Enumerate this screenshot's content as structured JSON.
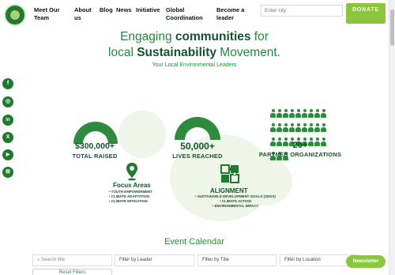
{
  "header": {
    "nav": [
      "Meet Our Team",
      "About us",
      "Blog",
      "News",
      "Initiative",
      "Global Coordination",
      "Become a leader"
    ],
    "search_placeholder": "Enter city",
    "donate_label": "DONATE"
  },
  "hero": {
    "line1_pre": "Engaging ",
    "line1_bold": "communities",
    "line1_post": " for",
    "line2_pre": "local ",
    "line2_bold": "Sustainability",
    "line2_post": " Movement.",
    "subtitle": "Your Local Environmental Leaders"
  },
  "social": [
    "f",
    "◎",
    "in",
    "X",
    "▶",
    "⊞"
  ],
  "social_icons": [
    "facebook-icon",
    "instagram-icon",
    "linkedin-icon",
    "x-icon",
    "youtube-icon",
    "blog-icon"
  ],
  "stats": [
    {
      "value": "$300,000+",
      "label": "TOTAL RAISED"
    },
    {
      "value": "50,000+",
      "label": "LIVES REACHED"
    },
    {
      "value": "20+",
      "label": "PARTNER ORGANIZATIONS"
    }
  ],
  "focus": {
    "title": "Focus Areas",
    "items": [
      "• YOUTH EMPOWERMENT",
      "• CLIMATE ADAPTATION",
      "• CLIMATE MITIGATION"
    ]
  },
  "alignment": {
    "title": "ALIGNMENT",
    "items": [
      "• SUSTAINABLE DEVELOPMENT GOALS (SDGS)",
      "• CLIMATE ACTION",
      "• ENVIRONMENTAL IMPACT"
    ]
  },
  "events": {
    "title": "Event Calendar",
    "search_placeholder": "Search title",
    "filter_leader": "Filter by Leader",
    "filter_title": "Filter by Title",
    "filter_location": "Filter by Location",
    "reset_label": "Reset Filters",
    "newsletter_label": "Newsletter"
  },
  "colors": {
    "brand_dark": "#14532d",
    "brand": "#1f8a3a",
    "accent": "#8cc63f"
  }
}
